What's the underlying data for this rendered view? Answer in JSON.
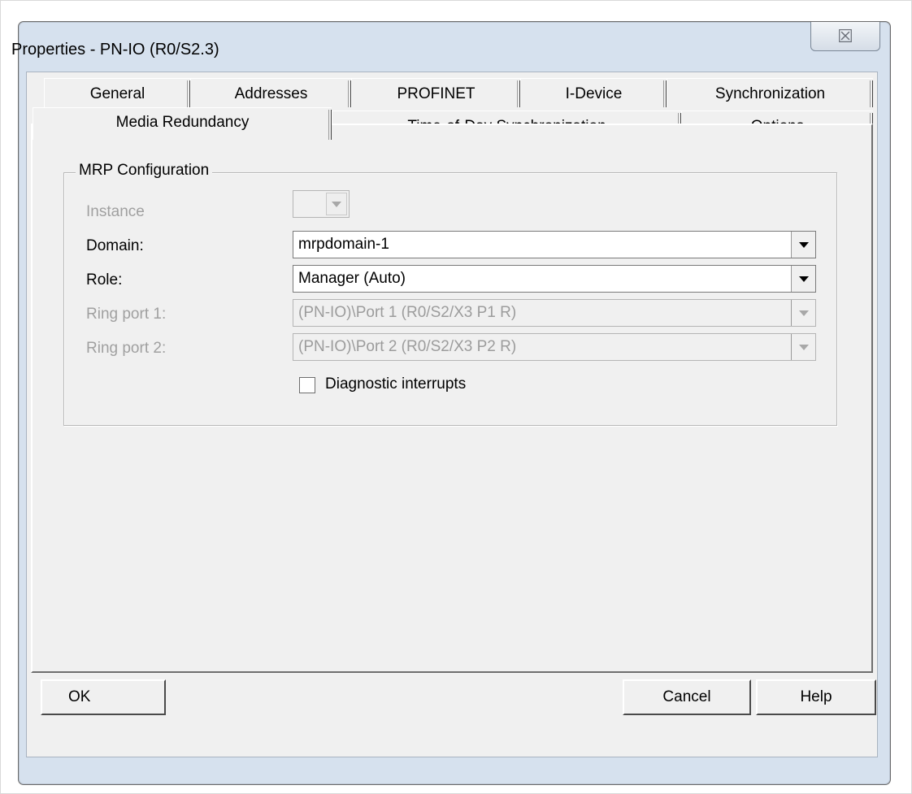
{
  "window": {
    "title": "Properties - PN-IO (R0/S2.3)",
    "close_glyph": "☒"
  },
  "tabs": {
    "row1": [
      "General",
      "Addresses",
      "PROFINET",
      "I-Device",
      "Synchronization"
    ],
    "row2": [
      "Media Redundancy",
      "Time-of-Day Synchronization",
      "Options"
    ],
    "active": "Media Redundancy"
  },
  "mrp": {
    "group_title": "MRP Configuration",
    "instance_label": "Instance",
    "instance_value": "",
    "domain_label": "Domain:",
    "domain_value": "mrpdomain-1",
    "role_label": "Role:",
    "role_value": "Manager (Auto)",
    "ring_port1_label": "Ring port 1:",
    "ring_port1_value": "(PN-IO)\\Port 1 (R0/S2/X3 P1 R)",
    "ring_port2_label": "Ring port 2:",
    "ring_port2_value": "(PN-IO)\\Port 2 (R0/S2/X3 P2 R)",
    "diagnostic_label": "Diagnostic interrupts",
    "diagnostic_checked": false
  },
  "buttons": {
    "ok": "OK",
    "cancel": "Cancel",
    "help": "Help"
  }
}
